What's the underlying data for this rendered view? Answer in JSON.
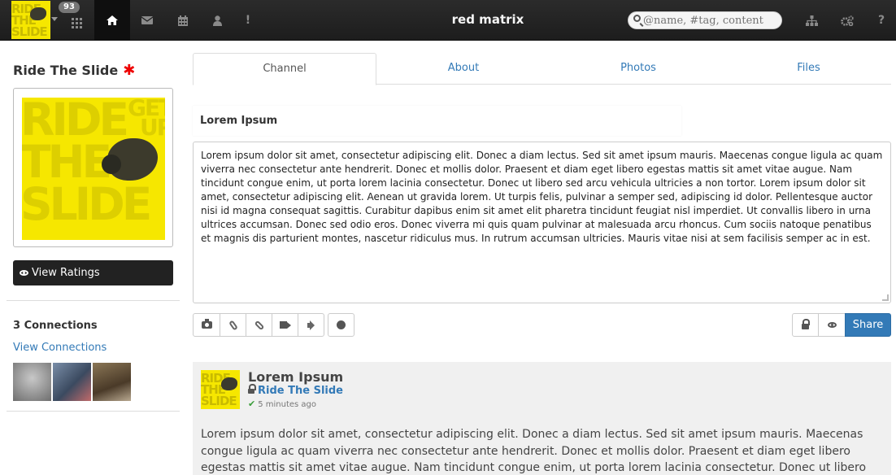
{
  "navbar": {
    "notification_count": "93",
    "title": "red matrix",
    "search_placeholder": "@name, #tag, content",
    "icons": [
      "apps-grid-icon",
      "home-icon",
      "envelope-icon",
      "calendar-icon",
      "user-icon",
      "exclamation-icon",
      "sitemap-icon",
      "cogs-icon",
      "help-icon"
    ],
    "icon_glyphs": {
      "exclamation": "!",
      "help": "?"
    }
  },
  "logo_text": [
    "RIDE",
    "THE",
    "SLIDE"
  ],
  "photo_text": [
    "RIDE",
    "THE",
    "SLIDE",
    "GET",
    "UP"
  ],
  "profile": {
    "name": "Ride The Slide",
    "mark": "✱",
    "view_ratings": "View Ratings"
  },
  "connections": {
    "title": "3 Connections",
    "view_link": "View Connections",
    "thumb_colors": [
      "#9a9a9a",
      "#5a6f8a",
      "#6a5a44"
    ]
  },
  "tabs": [
    {
      "label": "Channel",
      "active": true
    },
    {
      "label": "About"
    },
    {
      "label": "Photos"
    },
    {
      "label": "Files"
    }
  ],
  "editor": {
    "title": "Lorem Ipsum",
    "body": "Lorem ipsum dolor sit amet, consectetur adipiscing elit. Donec a diam lectus. Sed sit amet ipsum mauris. Maecenas congue ligula ac quam viverra nec consectetur ante hendrerit. Donec et mollis dolor. Praesent et diam eget libero egestas mattis sit amet vitae augue. Nam tincidunt congue enim, ut porta lorem lacinia consectetur. Donec ut libero sed arcu vehicula ultricies a non tortor. Lorem ipsum dolor sit amet, consectetur adipiscing elit. Aenean ut gravida lorem. Ut turpis felis, pulvinar a semper sed, adipiscing id dolor. Pellentesque auctor nisi id magna consequat sagittis. Curabitur dapibus enim sit amet elit pharetra tincidunt feugiat nisl imperdiet. Ut convallis libero in urna ultrices accumsan. Donec sed odio eros. Donec viverra mi quis quam pulvinar at malesuada arcu rhoncus. Cum sociis natoque penatibus et magnis dis parturient montes, nascetur ridiculus mus. In rutrum accumsan ultricies. Mauris vitae nisi at sem facilisis semper ac in est.",
    "toolbar_icons": [
      "camera-icon",
      "paperclip-icon",
      "link-icon",
      "video-icon",
      "volume-icon",
      "globe-icon"
    ],
    "right_icons": [
      "lock-icon",
      "eye-icon"
    ],
    "share_label": "Share"
  },
  "post": {
    "title": "Lorem Ipsum",
    "author": "Ride The Slide",
    "time": "5 minutes ago",
    "check": "✔",
    "body": "Lorem ipsum dolor sit amet, consectetur adipiscing elit. Donec a diam lectus. Sed sit amet ipsum mauris. Maecenas congue ligula ac quam viverra nec consectetur ante hendrerit. Donec et mollis dolor. Praesent et diam eget libero egestas mattis sit amet vitae augue. Nam tincidunt congue enim, ut porta lorem lacinia consectetur. Donec ut libero"
  },
  "colors": {
    "accent": "#337ab7",
    "navbar": "#222222",
    "logo_yellow": "#f6e700"
  }
}
